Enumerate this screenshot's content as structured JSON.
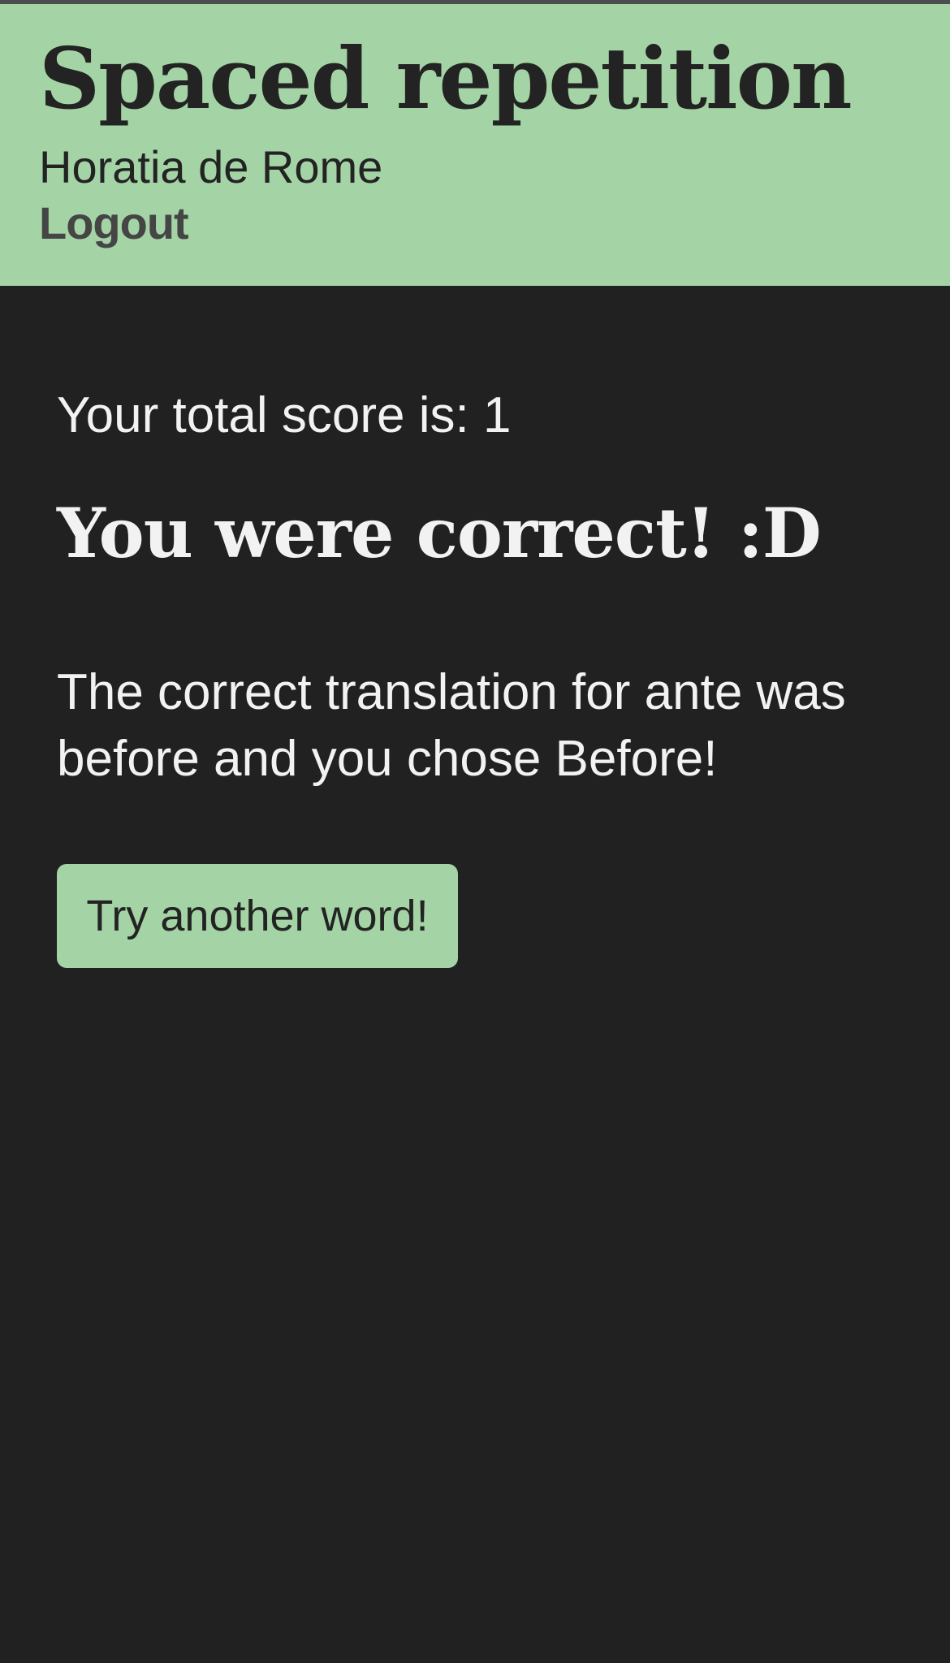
{
  "header": {
    "title": "Spaced repetition",
    "user_name": "Horatia de Rome",
    "logout_label": "Logout"
  },
  "main": {
    "score_text": "Your total score is: 1",
    "result_heading": "You were correct! :D",
    "feedback_text": "The correct translation for ante was before and you chose Before!",
    "next_button_label": "Try another word!"
  },
  "colors": {
    "header_background": "#a4d4a5",
    "page_background": "#212121",
    "button_background": "#a4d4a5",
    "text_light": "#f2f2f2",
    "text_dark": "#232323"
  }
}
